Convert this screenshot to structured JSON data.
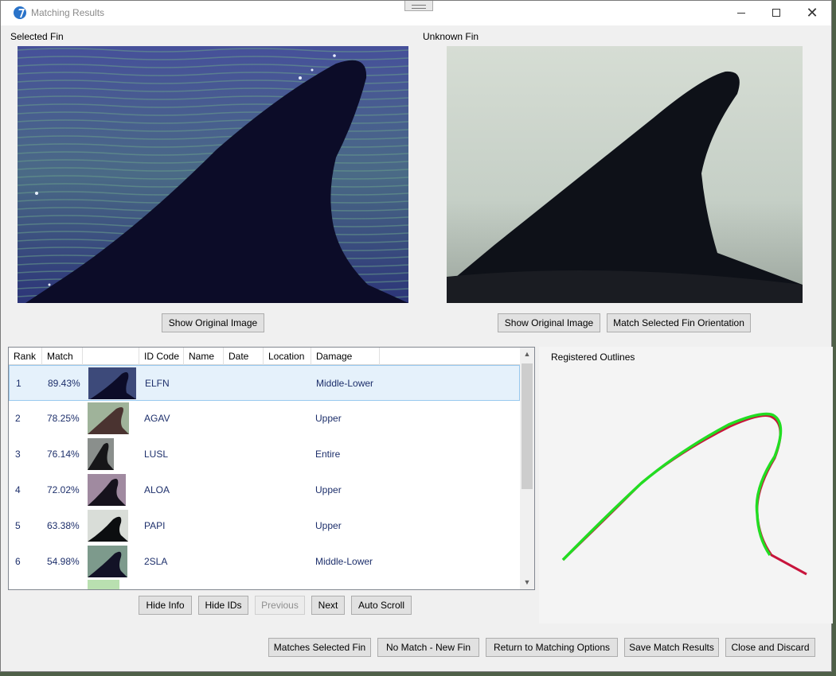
{
  "window": {
    "title": "Matching Results",
    "controls": {
      "minimize": "minimize",
      "maximize": "maximize",
      "close": "✕"
    }
  },
  "selected_fin": {
    "label": "Selected Fin",
    "show_original_label": "Show Original Image"
  },
  "unknown_fin": {
    "label": "Unknown Fin",
    "show_original_label": "Show Original Image",
    "match_orientation_label": "Match Selected Fin Orientation"
  },
  "results_table": {
    "columns": [
      "Rank",
      "Match",
      "",
      "ID Code",
      "Name",
      "Date",
      "Location",
      "Damage"
    ],
    "rows": [
      {
        "rank": "1",
        "match": "89.43%",
        "id_code": "ELFN",
        "name": "",
        "date": "",
        "location": "",
        "damage": "Middle-Lower",
        "selected": true
      },
      {
        "rank": "2",
        "match": "78.25%",
        "id_code": "AGAV",
        "name": "",
        "date": "",
        "location": "",
        "damage": "Upper"
      },
      {
        "rank": "3",
        "match": "76.14%",
        "id_code": "LUSL",
        "name": "",
        "date": "",
        "location": "",
        "damage": "Entire"
      },
      {
        "rank": "4",
        "match": "72.02%",
        "id_code": "ALOA",
        "name": "",
        "date": "",
        "location": "",
        "damage": "Upper"
      },
      {
        "rank": "5",
        "match": "63.38%",
        "id_code": "PAPI",
        "name": "",
        "date": "",
        "location": "",
        "damage": "Upper"
      },
      {
        "rank": "6",
        "match": "54.98%",
        "id_code": "2SLA",
        "name": "",
        "date": "",
        "location": "",
        "damage": "Middle-Lower"
      }
    ]
  },
  "list_buttons": {
    "hide_info": "Hide Info",
    "hide_ids": "Hide IDs",
    "previous": "Previous",
    "next": "Next",
    "auto_scroll": "Auto Scroll"
  },
  "outlines": {
    "label": "Registered Outlines",
    "colors": {
      "selected": "#c8143c",
      "unknown": "#22dd22"
    }
  },
  "footer_buttons": {
    "matches_selected": "Matches Selected Fin",
    "no_match": "No Match - New  Fin",
    "return_options": "Return to Matching Options",
    "save_results": "Save Match Results",
    "close_discard": "Close and Discard"
  },
  "colors": {
    "selection_bg": "#e5f1fb",
    "selection_border": "#99c9ef",
    "cell_text": "#1d2f6b"
  }
}
